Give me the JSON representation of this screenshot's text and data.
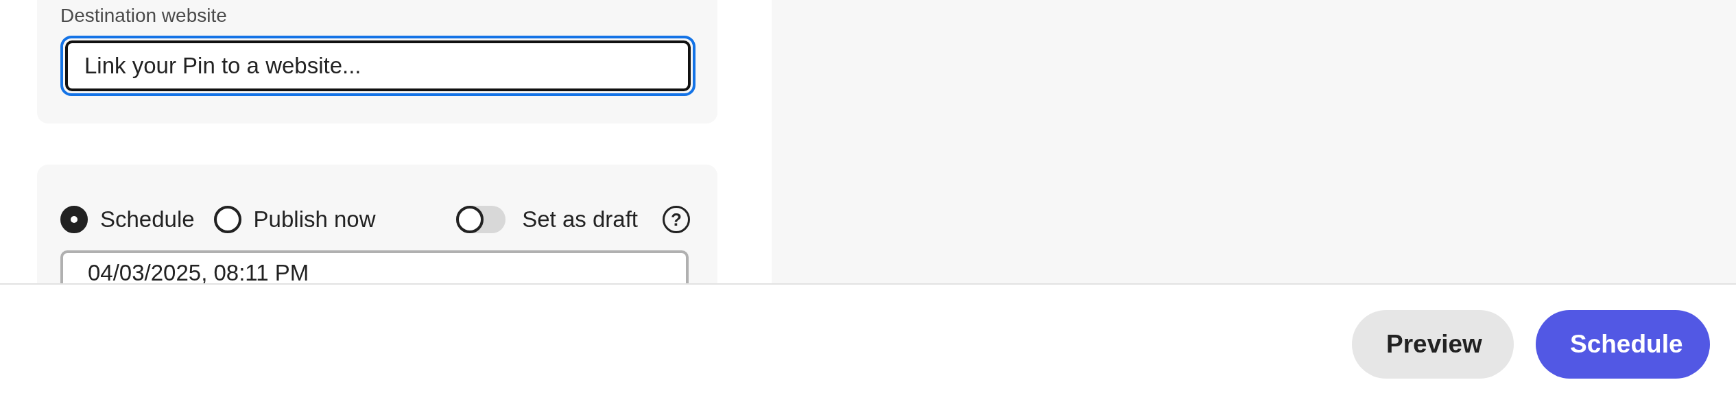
{
  "destination": {
    "label": "Destination website",
    "placeholder": "Link your Pin to a website...",
    "focused": true
  },
  "publish": {
    "options": [
      {
        "label": "Schedule",
        "selected": true
      },
      {
        "label": "Publish now",
        "selected": false
      }
    ],
    "draft": {
      "label": "Set as draft",
      "on": false
    },
    "help": "?",
    "date": "04/03/2025, 08:11 PM"
  },
  "footer": {
    "buttons": [
      {
        "label": "Preview",
        "kind": "secondary"
      },
      {
        "label": "Schedule",
        "kind": "primary"
      }
    ]
  }
}
